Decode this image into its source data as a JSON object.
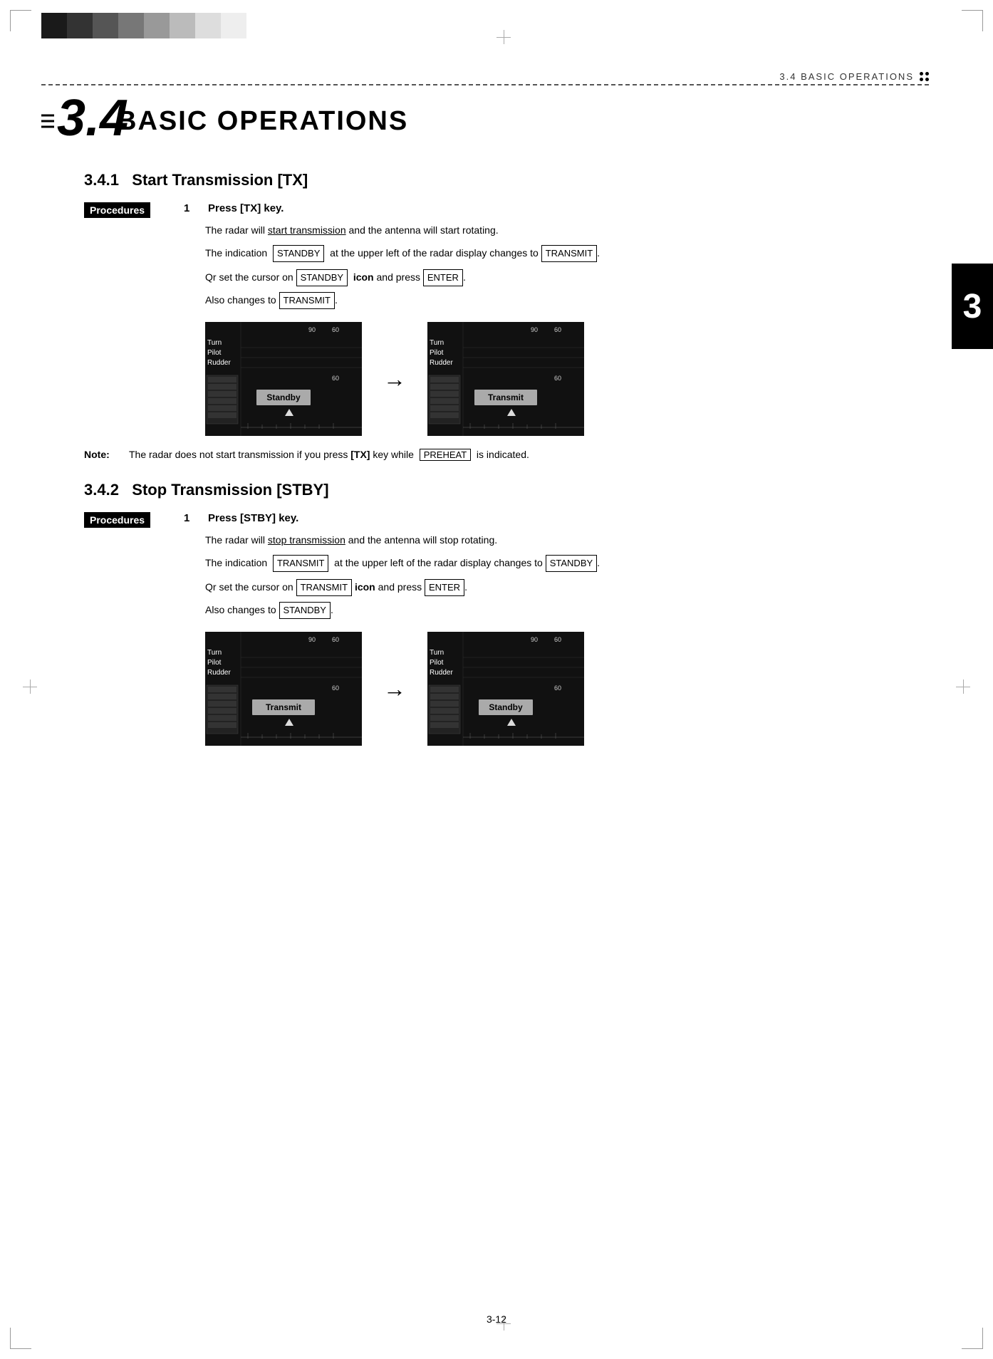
{
  "page": {
    "title": "3.4 BASIC OPERATIONS",
    "section_label": "3.4  BASIC OPERATIONS",
    "page_number": "3-12",
    "chapter_number": "3"
  },
  "color_squares": [
    "#1a1a1a",
    "#333333",
    "#555555",
    "#777777",
    "#999999",
    "#bbbbbb",
    "#dddddd",
    "#eeeeee"
  ],
  "header": {
    "section": "3.4  BASIC OPERATIONS"
  },
  "chapter": {
    "number": "3.4",
    "title": "BASIC OPERATIONS"
  },
  "sections": [
    {
      "id": "3.4.1",
      "heading": "3.4.1   Start Transmission [TX]",
      "procedures_label": "Procedures",
      "steps": [
        {
          "num": "1",
          "text": "Press [TX] key."
        }
      ],
      "body_lines": [
        "The radar will start transmission and the antenna will start rotating.",
        "The indication  STANDBY  at the upper left of the radar display changes to",
        "TRANSMIT .",
        "",
        "Qr set the cursor on  STANDBY   icon and press ENTER.",
        "Also changes to  TRANSMIT ."
      ],
      "note": "The radar does not start transmission if you press [TX] key while   PREHEAT   is indicated."
    },
    {
      "id": "3.4.2",
      "heading": "3.4.2   Stop Transmission [STBY]",
      "procedures_label": "Procedures",
      "steps": [
        {
          "num": "1",
          "text": "Press [STBY] key."
        }
      ],
      "body_lines": [
        "The radar will stop transmission and the antenna will stop rotating.",
        "The indication  TRANSMIT  at the upper left of the radar display changes to",
        "STANDBY .",
        "",
        "Qr set the cursor on  TRANSMIT  icon and press  ENTER .",
        "Also changes to  STANDBY ."
      ]
    }
  ],
  "radar": {
    "labels": [
      "Turn",
      "Pilot",
      "Rudder"
    ],
    "scale_top": "60",
    "scale_right": "90",
    "scale_mid": "60",
    "scale_bottom_left": "90",
    "standby_text": "Standby",
    "transmit_text": "Transmit"
  },
  "labels": {
    "note": "Note:",
    "procedures": "Procedures"
  }
}
